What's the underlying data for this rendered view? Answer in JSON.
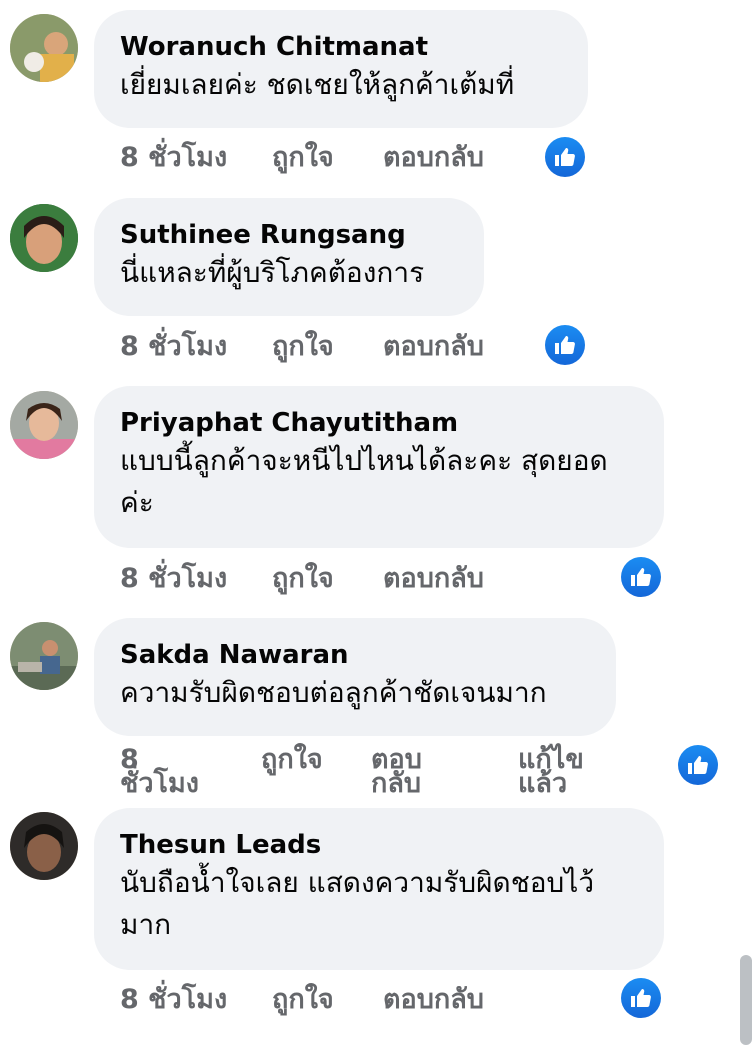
{
  "colors": {
    "bubble": "#f0f2f5",
    "meta_text": "#65676b",
    "like_blue": "#1877f2"
  },
  "comments": [
    {
      "author": "Woranuch Chitmanat",
      "text": "เยี่ยมเลยค่ะ ชดเชยให้ลูกค้าเต้มที่",
      "time": "8 ชั่วโมง",
      "like": "ถูกใจ",
      "reply": "ตอบกลับ",
      "reaction_icon": "like-icon"
    },
    {
      "author": "Suthinee Rungsang",
      "text": "นี่แหละที่ผู้บริโภคต้องการ",
      "time": "8 ชั่วโมง",
      "like": "ถูกใจ",
      "reply": "ตอบกลับ",
      "reaction_icon": "like-icon"
    },
    {
      "author": "Priyaphat Chayutitham",
      "text": "แบบนี้ลูกค้าจะหนีไปไหนได้ละคะ สุดยอดค่ะ",
      "time": "8 ชั่วโมง",
      "like": "ถูกใจ",
      "reply": "ตอบกลับ",
      "reaction_icon": "like-icon"
    },
    {
      "author": "Sakda Nawaran",
      "text": "ความรับผิดชอบต่อลูกค้าชัดเจนมาก",
      "time_num": "8",
      "time_unit": "ชั่วโมง",
      "like": "ถูกใจ",
      "reply_a": "ตอบ",
      "reply_b": "กลับ",
      "edited_a": "แก้ไข",
      "edited_b": "แล้ว",
      "reaction_icon": "like-icon"
    },
    {
      "author": "Thesun Leads",
      "text": "นับถือน้ำใจเลย แสดงความรับผิดชอบไว้มาก",
      "time": "8 ชั่วโมง",
      "like": "ถูกใจ",
      "reply": "ตอบกลับ",
      "reaction_icon": "like-icon"
    }
  ]
}
